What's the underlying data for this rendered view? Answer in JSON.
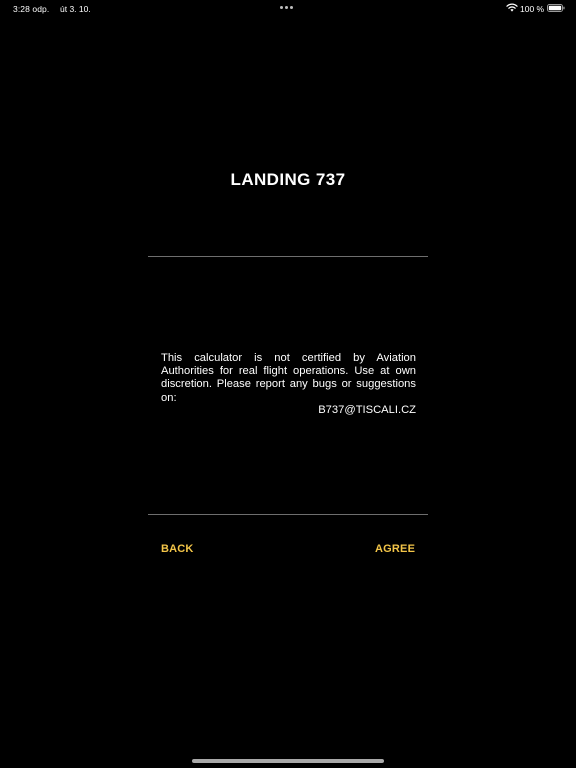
{
  "status_bar": {
    "time": "3:28 odp.",
    "date": "út 3. 10.",
    "battery_percent": "100 %",
    "wifi_icon": "wifi-icon",
    "battery_icon": "battery-full-icon"
  },
  "screen": {
    "title": "LANDING 737",
    "disclaimer": "This calculator is not certified by Aviation Authorities for real flight operations. Use at own discretion. Please report any bugs or suggestions on:",
    "email": "B737@TISCALI.CZ"
  },
  "actions": {
    "back_label": "BACK",
    "agree_label": "AGREE"
  },
  "colors": {
    "background": "#000000",
    "text": "#ffffff",
    "accent": "#f3c548",
    "divider": "#6e6e6e"
  }
}
